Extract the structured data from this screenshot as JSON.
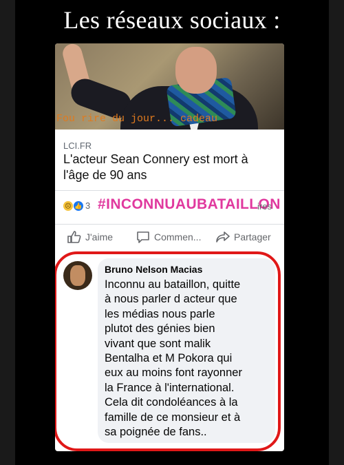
{
  "story": {
    "title": "Les réseaux sociaux :"
  },
  "post": {
    "overlay_text_1": "Fou rire du jour... cadeau",
    "source": "LCI.FR",
    "headline": "L'acteur Sean Connery est mort à l'âge de 90 ans",
    "reaction_count": "3",
    "hashtag": "#INCONNUAUBATAILLON",
    "comments_label": "ires",
    "actions": {
      "like": "J'aime",
      "comment": "Commen...",
      "share": "Partager"
    }
  },
  "comment": {
    "author": "Bruno Nelson Macias",
    "text": "Inconnu au bataillon,  quitte\nà nous parler d acteur que\nles médias nous parle\nplutot des génies bien\nvivant que sont malik\nBentalha et M Pokora qui\neux au moins font rayonner\nla France à l'international.\nCela dit condoléances à la\nfamille de ce monsieur et à\nsa poignée de fans.."
  },
  "colors": {
    "highlight_outline": "#e01818",
    "hashtag": "#e0399e",
    "overlay_caption": "#e07a1e"
  }
}
